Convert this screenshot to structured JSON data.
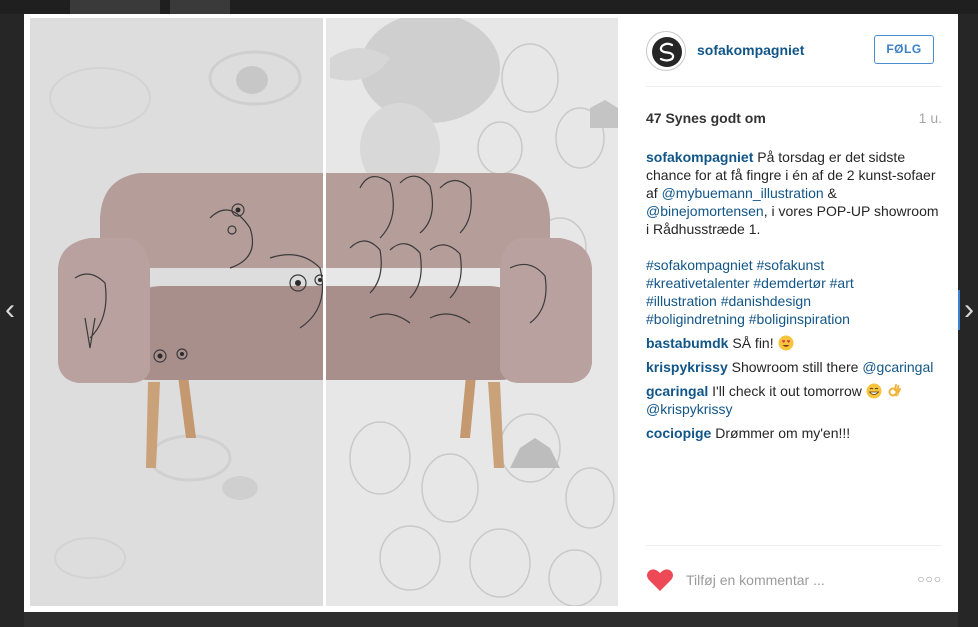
{
  "post": {
    "username": "sofakompagniet",
    "follow_label": "FØLG",
    "likes": "47 Synes godt om",
    "time_ago": "1 u.",
    "caption": {
      "user": "sofakompagniet",
      "text1": "På torsdag er det sidste chance for at få fingre i én af de 2 kunst-sofaer af",
      "mention1": "@mybuemann_illustration",
      "text2": "&",
      "mention2": "@binejomortensen",
      "text3": ", i vores POP-UP showroom i Rådhusstræde 1.",
      "tags_line1": "#sofakompagniet #sofakunst",
      "tags_line2": "#kreativetalenter #demdertør #art",
      "tags_line3": "#illustration #danishdesign",
      "tags_line4": "#boligindretning #boliginspiration"
    },
    "comments": [
      {
        "user": "bastabumdk",
        "text": "SÅ fin!",
        "emoji": "heart-eyes-emoji"
      },
      {
        "user": "krispykrissy",
        "text": "Showroom still there",
        "mention": "@gcaringal"
      },
      {
        "user": "gcaringal",
        "text": "I'll check it out tomorrow",
        "emoji": "grin-emoji",
        "emoji2": "ok-hand-emoji",
        "mention": "@krispykrissy"
      },
      {
        "user": "cociopige",
        "text": "Drømmer om my'en!!!"
      }
    ],
    "comment_placeholder": "Tilføj en kommentar ...",
    "more_label": "○○○"
  },
  "nav": {
    "prev_arrow": "‹",
    "next_arrow": "›",
    "prev_icon": "chevron-left-icon",
    "next_icon": "chevron-right-icon"
  },
  "colors": {
    "link": "#125688",
    "follow": "#3a7fc4",
    "like_heart": "#ed4956",
    "sofa_fabric": "#b59d9a",
    "sofa_legs": "#c9a27a"
  },
  "photo_icon": "sofa-photo"
}
